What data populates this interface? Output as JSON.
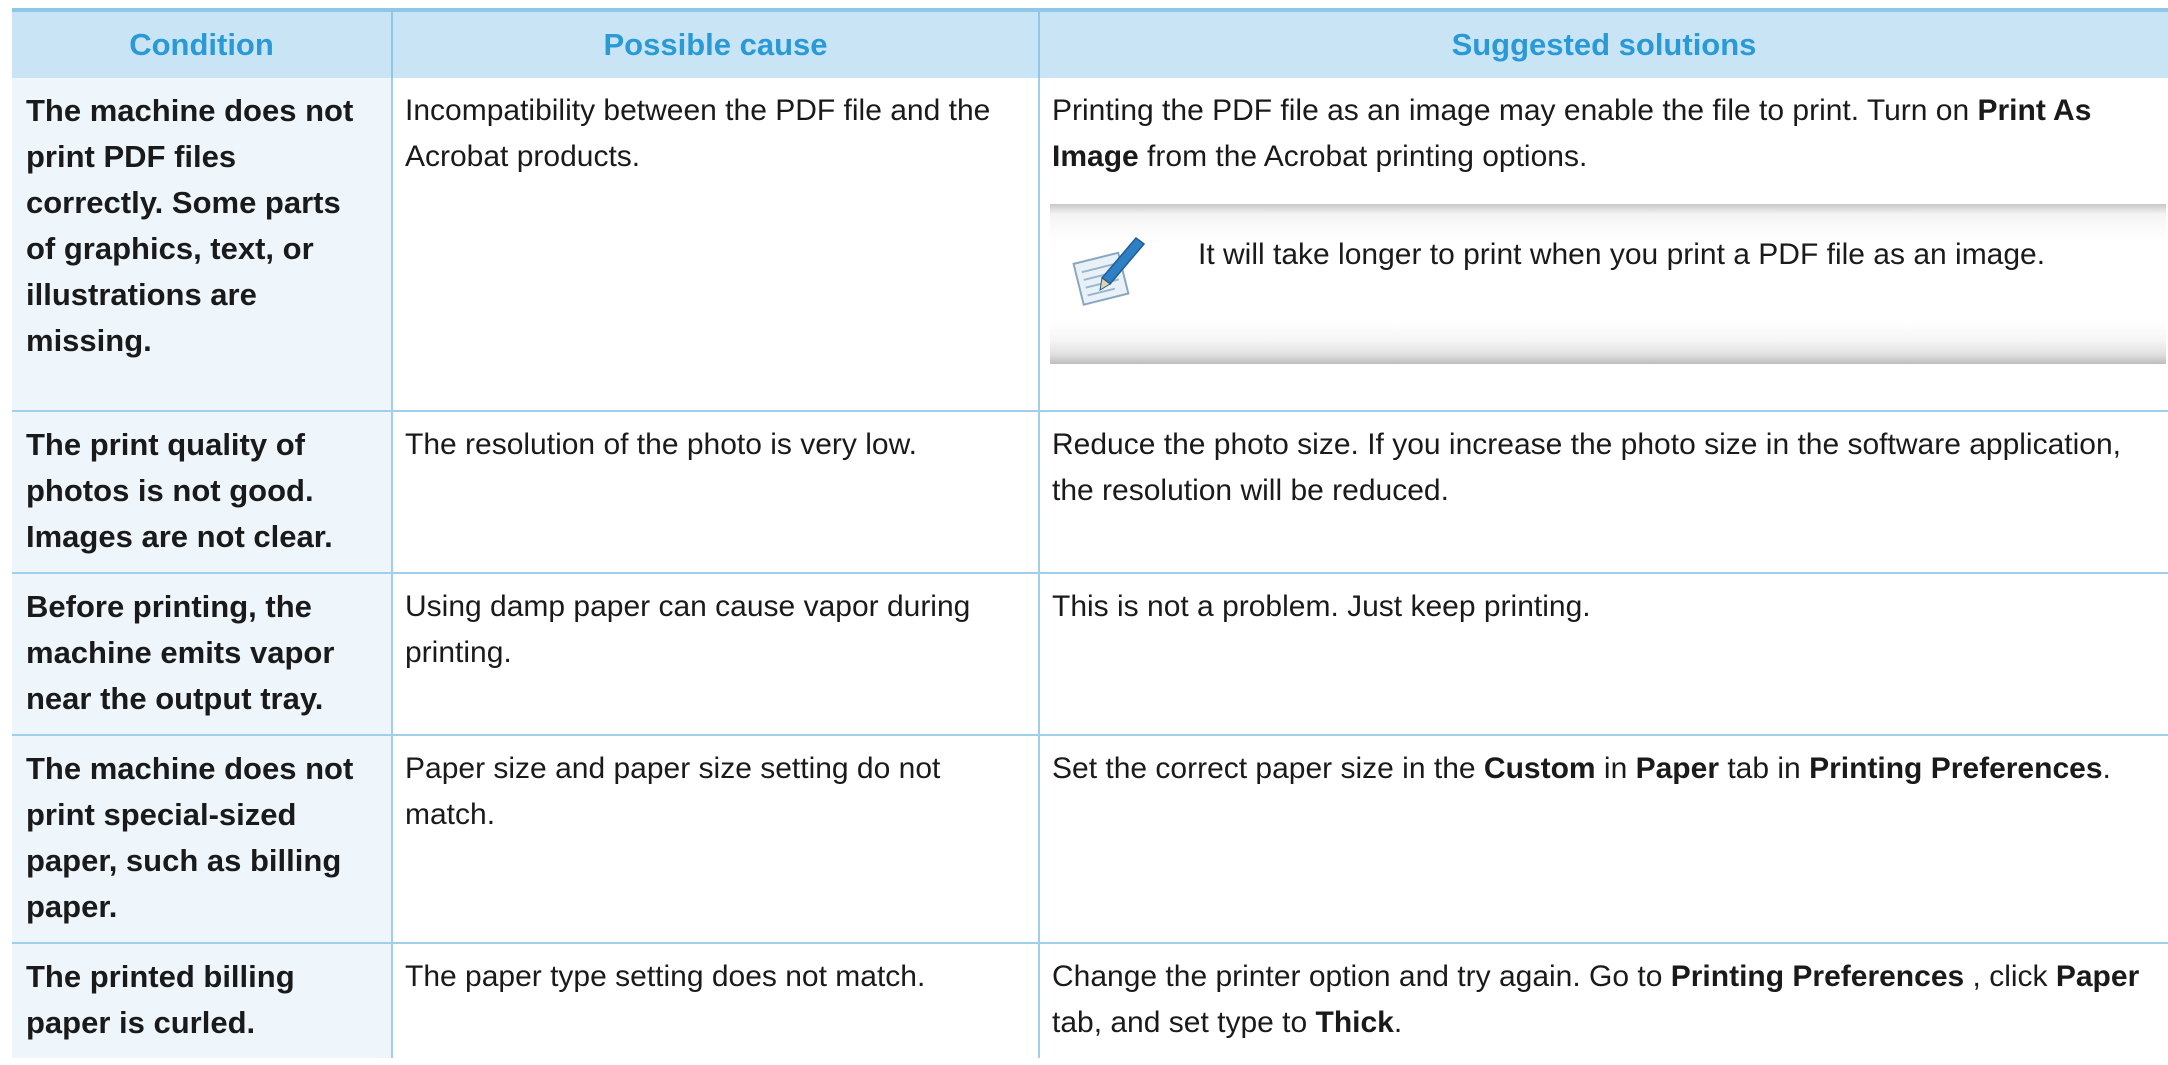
{
  "table": {
    "headers": {
      "condition": "Condition",
      "cause": "Possible cause",
      "solution": "Suggested solutions"
    },
    "rows": [
      {
        "condition": "The machine does not print PDF files correctly. Some parts of graphics, text, or illustrations are missing.",
        "cause": "Incompatibility between the PDF file and the Acrobat products.",
        "solution_parts": {
          "t1": "Printing the PDF file as an image may enable the file to print. Turn on ",
          "b1": "Print As Image",
          "t2": " from the Acrobat printing options."
        },
        "note": {
          "icon": "note-pencil-icon",
          "text": "It will take longer to print when you print a PDF file as an image."
        }
      },
      {
        "condition": "The print quality of photos is not good. Images are not clear.",
        "cause": "The resolution of the photo is very low.",
        "solution": "Reduce the photo size. If you increase the photo size in the software application, the resolution will be reduced."
      },
      {
        "condition": "Before printing, the machine emits vapor near the output tray.",
        "cause": "Using damp paper can cause vapor during printing.",
        "solution": "This is not a problem. Just keep printing."
      },
      {
        "condition": "The machine does not print special-sized paper, such as billing paper.",
        "cause": "Paper size and paper size setting do not match.",
        "solution_parts": {
          "t1": "Set the correct paper size in the ",
          "b1": "Custom",
          "t2": " in ",
          "b2": "Paper",
          "t3": " tab in ",
          "b3": "Printing Preferences",
          "t4": "."
        }
      },
      {
        "condition": "The printed billing paper is curled.",
        "cause": "The paper type setting does not match.",
        "solution_parts": {
          "t1": "Change the printer option and try again. Go to ",
          "b1": "Printing Preferences",
          "t2": " , click ",
          "b2": "Paper",
          "t3": " tab, and set type to ",
          "b3": "Thick",
          "t4": "."
        }
      }
    ]
  },
  "colors": {
    "header_bg": "#c9e4f5",
    "header_text": "#2a9ad6",
    "condition_bg": "#eef6fc",
    "rule": "#9fcfea"
  }
}
